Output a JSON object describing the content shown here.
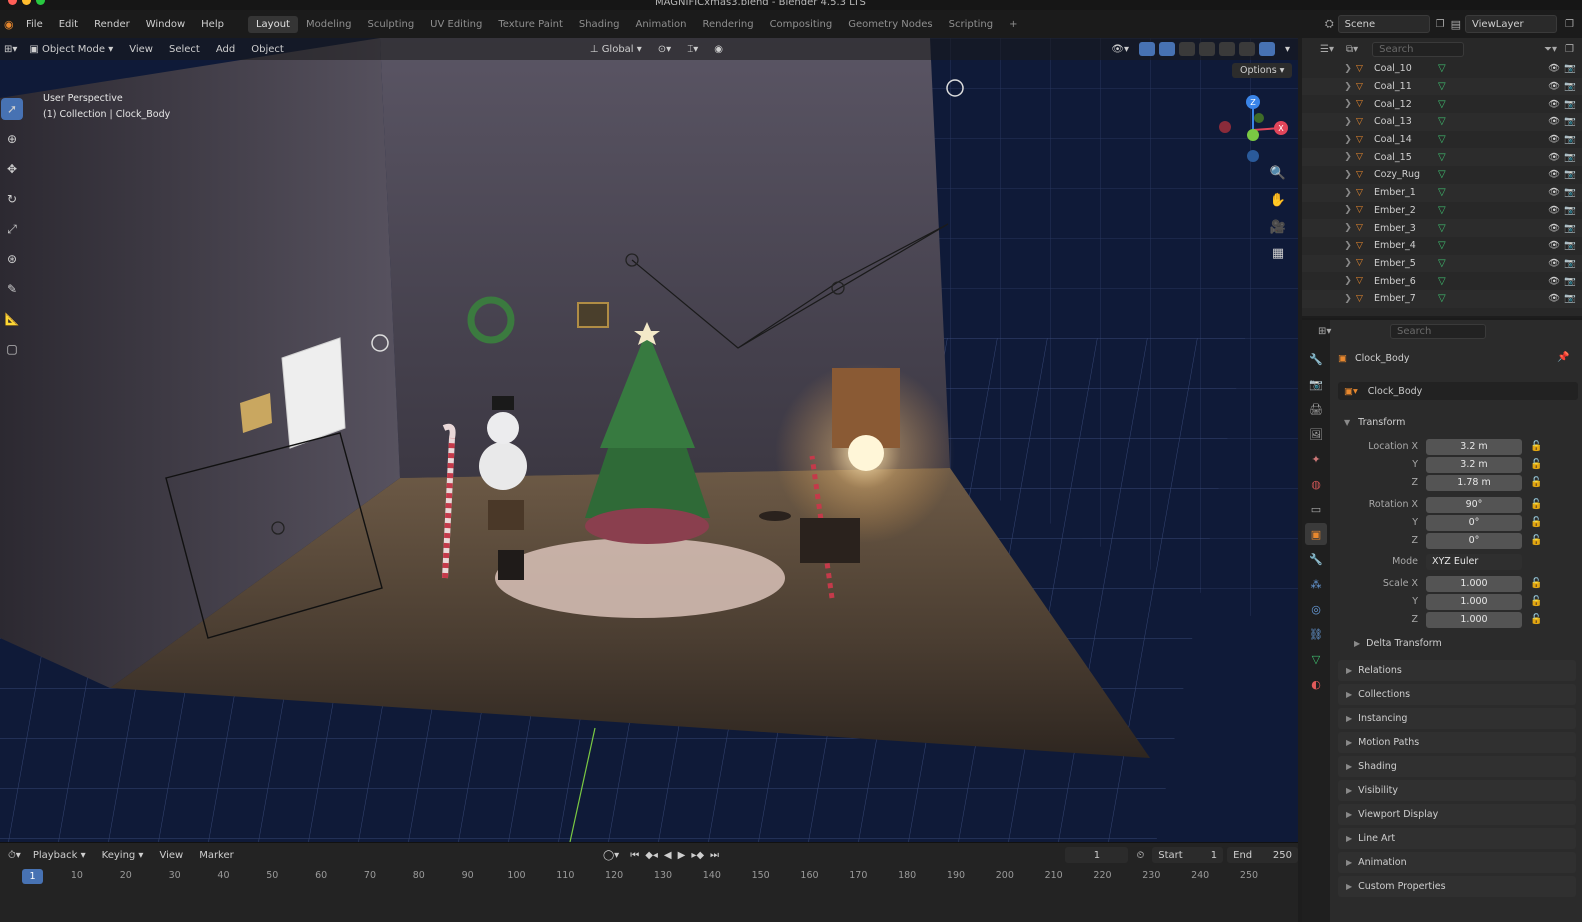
{
  "window": {
    "title": "MAGNIFICxmas3.blend - Blender 4.5.3 LTS"
  },
  "menu": [
    "File",
    "Edit",
    "Render",
    "Window",
    "Help"
  ],
  "workspaces": [
    {
      "label": "Layout",
      "active": true
    },
    {
      "label": "Modeling"
    },
    {
      "label": "Sculpting"
    },
    {
      "label": "UV Editing"
    },
    {
      "label": "Texture Paint"
    },
    {
      "label": "Shading"
    },
    {
      "label": "Animation"
    },
    {
      "label": "Rendering"
    },
    {
      "label": "Compositing"
    },
    {
      "label": "Geometry Nodes"
    },
    {
      "label": "Scripting"
    }
  ],
  "add_workspace": "+",
  "scene": {
    "scene_name": "Scene",
    "view_layer": "ViewLayer"
  },
  "viewport_header": {
    "mode": "Object Mode",
    "view": "View",
    "select": "Select",
    "add": "Add",
    "object": "Object",
    "orientation": "Global",
    "options": "Options"
  },
  "overlay": {
    "perspective": "User Perspective",
    "collection": "(1) Collection | Clock_Body"
  },
  "gizmo": {
    "x": "X",
    "y": "Y",
    "z": "Z"
  },
  "timeline": {
    "playback": "Playback",
    "keying": "Keying",
    "view": "View",
    "marker": "Marker",
    "current_frame": "1",
    "start_label": "Start",
    "start": "1",
    "end_label": "End",
    "end": "250",
    "ticks": [
      "1",
      "10",
      "20",
      "30",
      "40",
      "50",
      "60",
      "70",
      "80",
      "90",
      "100",
      "110",
      "120",
      "130",
      "140",
      "150",
      "160",
      "170",
      "180",
      "190",
      "200",
      "210",
      "220",
      "230",
      "240",
      "250"
    ]
  },
  "outliner": {
    "search_placeholder": "Search",
    "rows": [
      "Coal_10",
      "Coal_11",
      "Coal_12",
      "Coal_13",
      "Coal_14",
      "Coal_15",
      "Cozy_Rug",
      "Ember_1",
      "Ember_2",
      "Ember_3",
      "Ember_4",
      "Ember_5",
      "Ember_6",
      "Ember_7"
    ]
  },
  "properties": {
    "search_placeholder": "Search",
    "object_name": "Clock_Body",
    "object_field": "Clock_Body",
    "transform_header": "Transform",
    "location": {
      "label": "Location X",
      "x": "3.2 m",
      "y": "3.2 m",
      "z": "1.78 m"
    },
    "rotation": {
      "label": "Rotation X",
      "x": "90°",
      "y": "0°",
      "z": "0°"
    },
    "mode_label": "Mode",
    "mode_value": "XYZ Euler",
    "scale": {
      "label": "Scale X",
      "x": "1.000",
      "y": "1.000",
      "z": "1.000"
    },
    "axis_y": "Y",
    "axis_z": "Z",
    "delta_transform": "Delta Transform",
    "panels": [
      "Relations",
      "Collections",
      "Instancing",
      "Motion Paths",
      "Shading",
      "Visibility",
      "Viewport Display",
      "Line Art",
      "Animation",
      "Custom Properties"
    ]
  },
  "colors": {
    "accent": "#4772b3",
    "object_orange": "#e8882e",
    "mesh_green": "#3fbf6f",
    "axis_x": "#e0455a",
    "axis_y": "#7ac943",
    "axis_z": "#3a84e8"
  }
}
